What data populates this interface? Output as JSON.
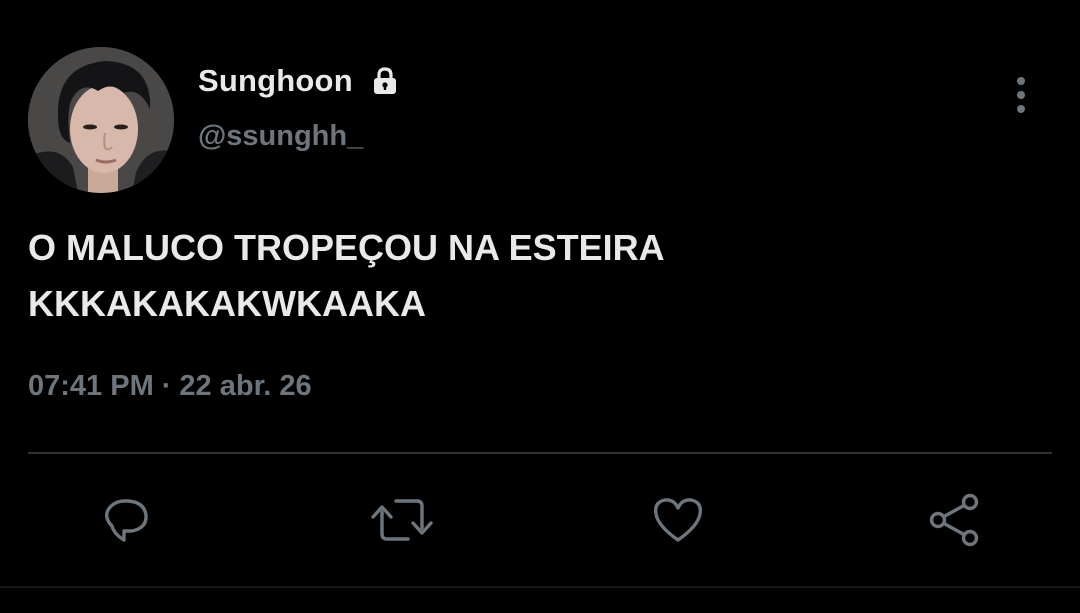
{
  "tweet": {
    "author": {
      "display_name": "Sunghoon",
      "handle": "@ssunghh_",
      "avatar_icon": "profile-photo",
      "protected_icon": "lock-icon"
    },
    "text_lines": [
      "O MALUCO TROPEÇOU NA ESTEIRA",
      "KKKAKAKAKWKAAKA"
    ],
    "time": "07:41 PM",
    "separator": "·",
    "date": "22 abr. 26"
  },
  "actions": [
    {
      "name": "reply",
      "icon": "speech-bubble-icon"
    },
    {
      "name": "retweet",
      "icon": "retweet-arrows-icon"
    },
    {
      "name": "like",
      "icon": "heart-icon"
    },
    {
      "name": "share",
      "icon": "share-icon"
    }
  ],
  "more_menu": {
    "icon": "vertical-ellipsis-icon"
  },
  "colors": {
    "background": "#000000",
    "primary_text": "#e7e9ea",
    "secondary_text": "#6e767d",
    "icon": "#6e767d",
    "divider": "#2f3336"
  }
}
